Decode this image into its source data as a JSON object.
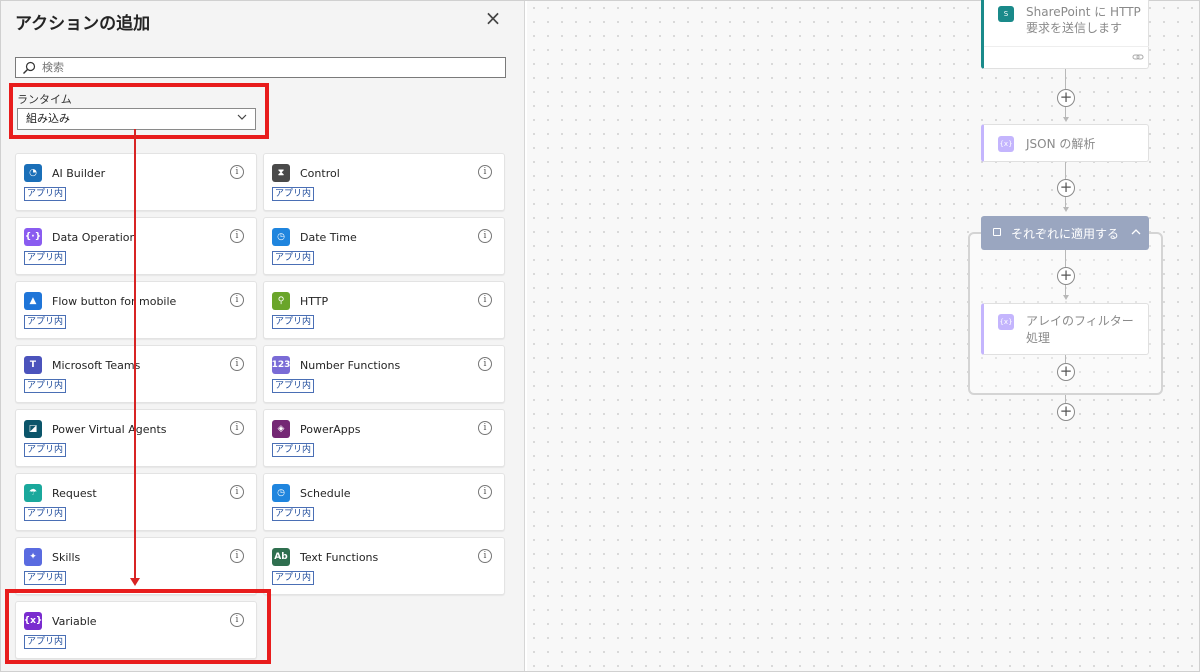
{
  "panel": {
    "title": "アクションの追加",
    "close_glyph": "×",
    "search": {
      "placeholder": "検索"
    },
    "runtime": {
      "label": "ランタイム",
      "selected": "組み込み"
    },
    "badge_text": "アプリ内",
    "info_glyph": "i",
    "connectors": [
      {
        "name": "AI Builder",
        "icon": "ai-builder-icon",
        "color": "#1a6fb8"
      },
      {
        "name": "Control",
        "icon": "control-icon",
        "color": "#4a4a4a"
      },
      {
        "name": "Data Operation",
        "icon": "data-operation-icon",
        "color": "#8a5cf0"
      },
      {
        "name": "Date Time",
        "icon": "date-time-icon",
        "color": "#1f85de"
      },
      {
        "name": "Flow button for mobile",
        "icon": "flow-button-icon",
        "color": "#1f75d8"
      },
      {
        "name": "HTTP",
        "icon": "http-icon",
        "color": "#6aa52a"
      },
      {
        "name": "Microsoft Teams",
        "icon": "teams-icon",
        "color": "#4b53bc"
      },
      {
        "name": "Number Functions",
        "icon": "number-functions-icon",
        "color": "#7a6bd6"
      },
      {
        "name": "Power Virtual Agents",
        "icon": "power-virtual-agents-icon",
        "color": "#0b556a"
      },
      {
        "name": "PowerApps",
        "icon": "powerapps-icon",
        "color": "#742774"
      },
      {
        "name": "Request",
        "icon": "request-icon",
        "color": "#1aa89c"
      },
      {
        "name": "Schedule",
        "icon": "schedule-icon",
        "color": "#1f85de"
      },
      {
        "name": "Skills",
        "icon": "skills-icon",
        "color": "#5a6be0"
      },
      {
        "name": "Text Functions",
        "icon": "text-functions-icon",
        "color": "#2f6f4f"
      },
      {
        "name": "Variable",
        "icon": "variable-icon",
        "color": "#7a2ccf"
      }
    ]
  },
  "flow": {
    "sharepoint_card": {
      "text_line1": "SharePoint に HTTP",
      "text_line2": "要求を送信します",
      "icon": "sharepoint-icon",
      "color": "#1a8a8a"
    },
    "json_card": {
      "text": "JSON の解析",
      "icon": "json-parse-icon",
      "color": "#a78bfa"
    },
    "apply_each": {
      "label": "それぞれに適用する",
      "icon": "loop-icon",
      "color": "#8a98b8"
    },
    "filter_card": {
      "text_line1": "アレイのフィルター",
      "text_line2": "処理",
      "icon": "filter-array-icon",
      "color": "#a78bfa"
    },
    "add_glyph": "+"
  }
}
